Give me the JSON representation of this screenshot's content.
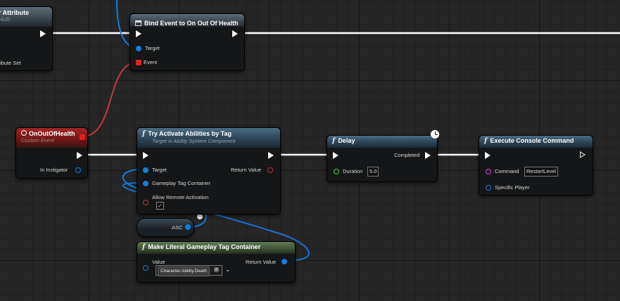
{
  "graph": {
    "nodes": {
      "get_attribute": {
        "title": "r Attribute",
        "subtitle": "HUD",
        "pin_label": "ibute Set"
      },
      "bind_event": {
        "title": "Bind Event to On Out Of Health",
        "target_label": "Target",
        "event_label": "Event"
      },
      "on_out_of_health": {
        "title": "OnOutOfHealth",
        "subtitle": "Custom Event",
        "instigator_label": "In Instigator"
      },
      "try_activate": {
        "title": "Try Activate Abilities by Tag",
        "subtitle": "Target is Ability System Component",
        "target_label": "Target",
        "tag_container_label": "Gameplay Tag Container",
        "allow_remote_label": "Allow Remote Activation",
        "return_label": "Return Value",
        "allow_remote_checked": "✓"
      },
      "asc_variable": {
        "label": "ASC"
      },
      "make_literal": {
        "title": "Make Literal Gameplay Tag Container",
        "value_label": "Value",
        "return_label": "Return Value",
        "tag_value": "Character.Ability.Death",
        "remove_glyph": "✕",
        "dropdown_glyph": "⌄"
      },
      "delay": {
        "title": "Delay",
        "completed_label": "Completed",
        "duration_label": "Duration",
        "duration_value": "5.0"
      },
      "execute_console": {
        "title": "Execute Console Command",
        "command_label": "Command",
        "command_value": "RestartLevel",
        "specific_player_label": "Specific Player"
      }
    },
    "function_glyph": "f",
    "colors": {
      "exec_wire": "#ffffff",
      "object_wire": "#0e7fe0",
      "event_wire": "#c23a3a",
      "tag_wire": "#1c6fd0"
    }
  }
}
